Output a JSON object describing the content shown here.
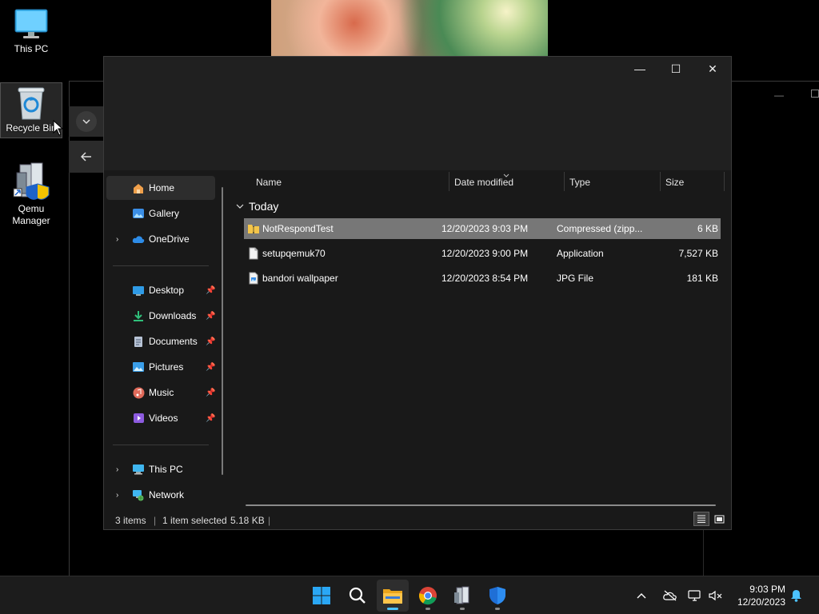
{
  "desktop": {
    "icons": [
      {
        "label": "This PC"
      },
      {
        "label": "Recycle Bin"
      },
      {
        "label": "Qemu Manager"
      }
    ]
  },
  "explorer": {
    "window_controls": {
      "minimize": "—",
      "maximize": "☐",
      "close": "✕"
    },
    "nav": {
      "items": [
        {
          "label": "Home",
          "icon": "home-icon"
        },
        {
          "label": "Gallery",
          "icon": "gallery-icon"
        },
        {
          "label": "OneDrive",
          "icon": "cloud-icon"
        },
        {
          "label": "Desktop",
          "icon": "desktop-icon"
        },
        {
          "label": "Downloads",
          "icon": "download-icon"
        },
        {
          "label": "Documents",
          "icon": "document-icon"
        },
        {
          "label": "Pictures",
          "icon": "pictures-icon"
        },
        {
          "label": "Music",
          "icon": "music-icon"
        },
        {
          "label": "Videos",
          "icon": "videos-icon"
        },
        {
          "label": "This PC",
          "icon": "computer-icon"
        },
        {
          "label": "Network",
          "icon": "network-icon"
        }
      ]
    },
    "columns": {
      "name": "Name",
      "date": "Date modified",
      "type": "Type",
      "size": "Size"
    },
    "group": {
      "label": "Today"
    },
    "files": [
      {
        "name": "NotRespondTest",
        "date": "12/20/2023 9:03 PM",
        "type": "Compressed (zipp...",
        "size": "6 KB",
        "icon": "zip-folder-icon",
        "selected": true
      },
      {
        "name": "setupqemuk70",
        "date": "12/20/2023 9:00 PM",
        "type": "Application",
        "size": "7,527 KB",
        "icon": "file-icon",
        "selected": false
      },
      {
        "name": "bandori wallpaper",
        "date": "12/20/2023 8:54 PM",
        "type": "JPG File",
        "size": "181 KB",
        "icon": "image-file-icon",
        "selected": false
      }
    ],
    "status": {
      "items": "3 items",
      "selection": "1 item selected",
      "size": "5.18 KB"
    }
  },
  "taskbar": {
    "clock_time": "9:03 PM",
    "clock_date": "12/20/2023"
  },
  "colors": {
    "accent": "#4cc2ff",
    "selection": "#777777",
    "window_bg": "#191919"
  }
}
